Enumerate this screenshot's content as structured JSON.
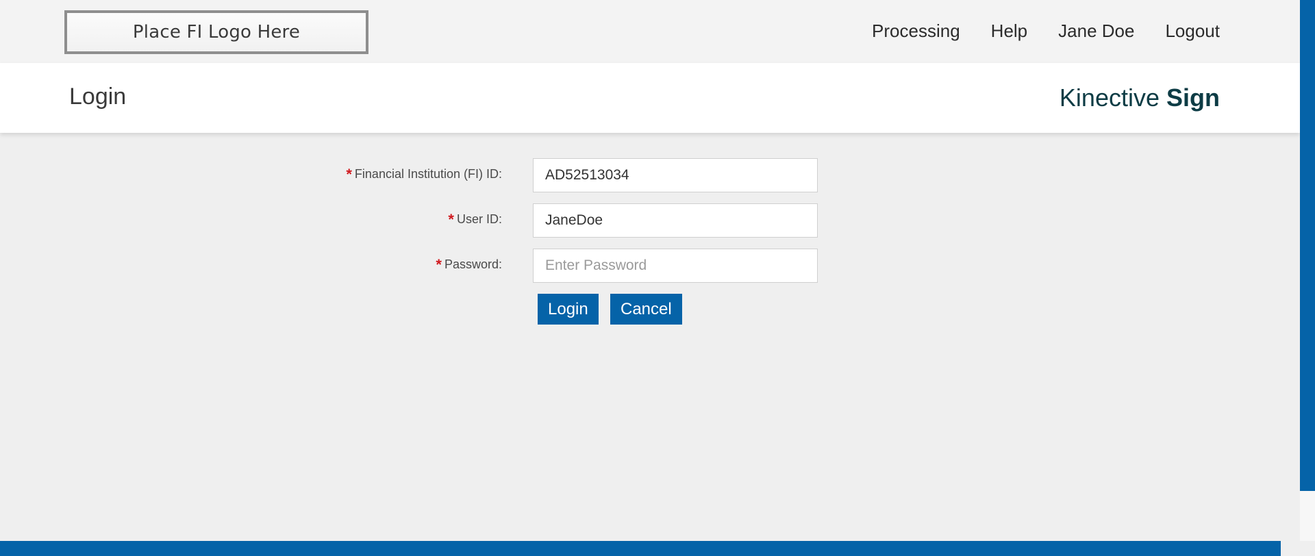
{
  "topbar": {
    "logo_text": "Place FI Logo Here",
    "nav": {
      "processing": "Processing",
      "help": "Help",
      "user": "Jane Doe",
      "logout": "Logout"
    }
  },
  "header": {
    "title": "Login",
    "brand_light": "Kinective",
    "brand_bold": "Sign"
  },
  "form": {
    "required_marker": "*",
    "fi_id": {
      "label": "Financial Institution (FI) ID:",
      "value": "AD52513034"
    },
    "user_id": {
      "label": "User ID:",
      "value": "JaneDoe"
    },
    "password": {
      "label": "Password:",
      "value": "",
      "placeholder": "Enter Password"
    },
    "login_label": "Login",
    "cancel_label": "Cancel"
  },
  "colors": {
    "accent": "#0563a8",
    "required": "#d0191e",
    "brand": "#0d3c45"
  }
}
